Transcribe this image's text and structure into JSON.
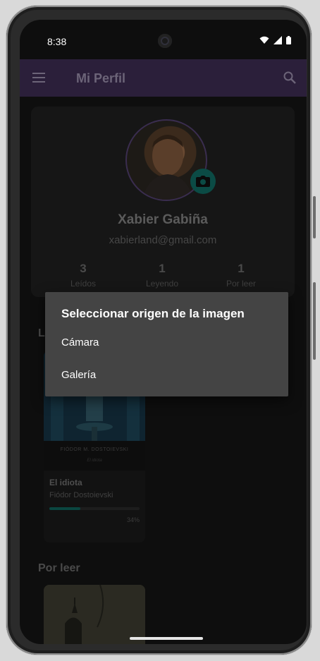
{
  "status_bar": {
    "time": "8:38"
  },
  "app_bar": {
    "title": "Mi Perfil",
    "menu_icon": "menu-icon",
    "search_icon": "search-icon"
  },
  "profile": {
    "name": "Xabier Gabiña",
    "email": "xabierland@gmail.com",
    "stats": [
      {
        "value": "3",
        "label": "Leídos"
      },
      {
        "value": "1",
        "label": "Leyendo"
      },
      {
        "value": "1",
        "label": "Por leer"
      }
    ]
  },
  "reading_section": {
    "title_partial": "Le",
    "book": {
      "cover_author": "FIÓDOR M. DOSTOIEVSKI",
      "cover_subtitle": "El idiota",
      "title": "El idiota",
      "author": "Fiódor Dostoievski",
      "progress_percent": 34,
      "progress_label": "34%"
    }
  },
  "to_read_section": {
    "title": "Por leer"
  },
  "dialog": {
    "title": "Seleccionar origen de la imagen",
    "options": [
      "Cámara",
      "Galería"
    ]
  },
  "colors": {
    "app_bar": "#2b1f3a",
    "accent_teal": "#0b4b45",
    "dialog_bg": "#444444"
  }
}
